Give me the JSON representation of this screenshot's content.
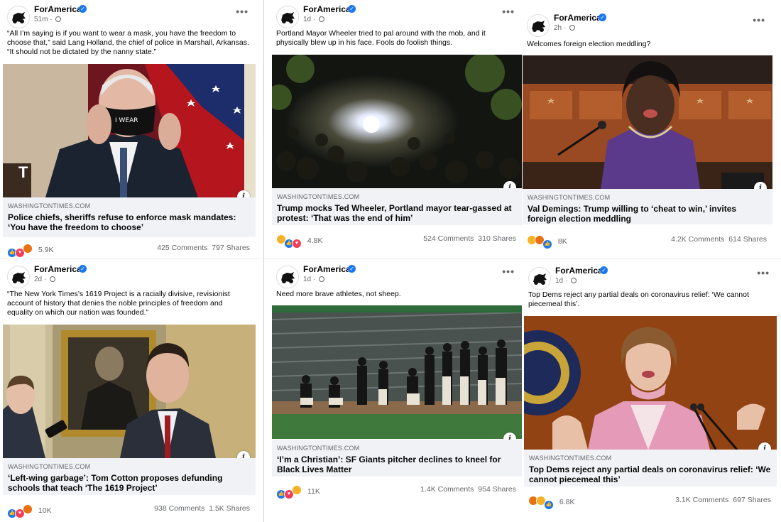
{
  "page_name": "ForAmerica",
  "verified_mark": "✓",
  "more_glyph": "•••",
  "info_glyph": "i",
  "posts": [
    {
      "time": "51m",
      "caption": "“All I’m saying is if you want to wear a mask, you have the freedom to choose that,” said Lang Holland, the chief of police in Marshall, Arkansas. “It should not be dictated by the nanny state.”",
      "domain": "WASHINGTONTIMES.COM",
      "headline": "Police chiefs, sheriffs refuse to enforce mask mandates: ‘You have the freedom to choose’",
      "reactions_count": "5.9K",
      "reaction_icons": [
        "like-icon",
        "love-icon",
        "angry-icon"
      ],
      "comments": "425 Comments",
      "shares": "797 Shares"
    },
    {
      "time": "1d",
      "caption": "Portland Mayor Wheeler tried to pal around with the mob, and it physically blew up in his face. Fools do foolish things.",
      "domain": "WASHINGTONTIMES.COM",
      "headline": "Trump mocks Ted Wheeler, Portland mayor tear-gassed at protest: ‘That was the end of him’",
      "reactions_count": "4.8K",
      "reaction_icons": [
        "haha-icon",
        "like-icon",
        "love-icon"
      ],
      "comments": "524 Comments",
      "shares": "310 Shares"
    },
    {
      "time": "2h",
      "caption": "Welcomes foreign election meddling?",
      "domain": "WASHINGTONTIMES.COM",
      "headline": "Val Demings: Trump willing to ‘cheat to win,’ invites foreign election meddling",
      "reactions_count": "8K",
      "reaction_icons": [
        "haha-icon",
        "angry-icon",
        "like-icon"
      ],
      "comments": "4.2K Comments",
      "shares": "614 Shares"
    },
    {
      "time": "2d",
      "caption": "“The New York Times’s 1619 Project is a racially divisive, revisionist account of history that denies the noble principles of freedom and equality on which our nation was founded.”",
      "domain": "WASHINGTONTIMES.COM",
      "headline": "‘Left-wing garbage’: Tom Cotton proposes defunding schools that teach ‘The 1619 Project’",
      "reactions_count": "10K",
      "reaction_icons": [
        "like-icon",
        "love-icon",
        "angry-icon"
      ],
      "comments": "938 Comments",
      "shares": "1.5K Shares"
    },
    {
      "time": "1d",
      "caption": "Need more brave athletes, not sheep.",
      "domain": "WASHINGTONTIMES.COM",
      "headline": "‘I’m a Christian’: SF Giants pitcher declines to kneel for Black Lives Matter",
      "reactions_count": "11K",
      "reaction_icons": [
        "like-icon",
        "love-icon",
        "care-icon"
      ],
      "comments": "1.4K Comments",
      "shares": "954 Shares"
    },
    {
      "time": "1d",
      "caption": "Top Dems reject any partial deals on coronavirus relief: ‘We cannot piecemeal this’.",
      "domain": "WASHINGTONTIMES.COM",
      "headline": "Top Dems reject any partial deals on coronavirus relief: ‘We cannot piecemeal this’",
      "reactions_count": "6.8K",
      "reaction_icons": [
        "angry-icon",
        "haha-icon",
        "like-icon"
      ],
      "comments": "3.1K Comments",
      "shares": "697 Shares"
    }
  ],
  "colors": {
    "fb_blue": "#1877f2",
    "link_bg": "#f0f2f5",
    "meta_gray": "#65676b"
  }
}
